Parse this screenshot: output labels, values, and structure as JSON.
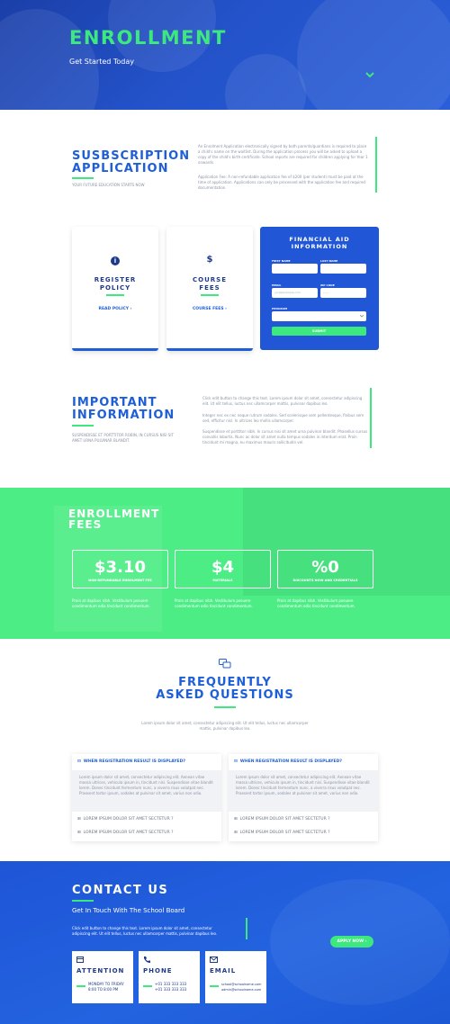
{
  "hero": {
    "title": "ENROLLMENT",
    "subtitle": "Get Started Today"
  },
  "subscription": {
    "title_line1": "SUSBSCRIPTION",
    "title_line2": "APPLICATION",
    "tagline": "YOUR FUTURE EDUCATION STARTS NOW",
    "para1": "An Enrolment Application electronically signed by both parents/guardians is required to place a child's name on the waitlist. During the application process you will be asked to upload a copy of the child's birth certificate. School reports are required for children applying for Year 1 onwards.",
    "para2": "Application Fee: A non-refundable application fee of $200 (per student) must be paid at the time of application. Applications can only be processed with the application fee and required documentation."
  },
  "cards": [
    {
      "title_line1": "REGISTER",
      "title_line2": "POLICY",
      "link": "READ POLICY",
      "icon": "info-icon",
      "icon_glyph": "i"
    },
    {
      "title_line1": "COURSE",
      "title_line2": "FEES",
      "link": "COURSE FEES",
      "icon": "dollar-icon",
      "icon_glyph": "$"
    }
  ],
  "aid_form": {
    "title_line1": "FINANCIAL AID",
    "title_line2": "INFORMATION",
    "first_name": "FIRST NAME",
    "last_name": "LAST NAME",
    "email": "EMAIL",
    "email_placeholder": "you@example.com",
    "zip": "ZIP CODE",
    "zip_placeholder": "------",
    "program": "PROGRAM",
    "submit": "SUBMIT"
  },
  "important": {
    "title_line1": "IMPORTANT",
    "title_line2": "INFORMATION",
    "tagline": "SUSPENDISSE ET PORTTITOR ROBIN, IN CURSUS NISI SIT AMET URNA PULVINAR BLANDIT.",
    "para1": "Click edit button to change this text. Lorem ipsum dolor sit amet, consectetur adipiscing elit. Ut elit tellus, luctus nec ullamcorper mattis, pulvinar dapibus leo.",
    "para2": "Integer nec ex nec neque rutrum sodales. Sed scelerisque sem pellentesque, finibus sem sed, efficitur nisl. In ultrices leo mollis ullamcorper.",
    "para3": "Suspendisse et porttitor nibh. In cursus nisi sit amet urna pulvinar blandit. Phasellus cursus convallis lobortis. Nunc ac dolor sit amet nulla tempus sodales in interdum erat. Proin tincidunt mi magna, eu maximus mauris sollicitudin vel."
  },
  "fees": {
    "title_line1": "ENROLLMENT",
    "title_line2": "FEES",
    "boxes": [
      {
        "value": "$3.10",
        "label": "NON-REFUNDABLE ENROLMENT FEE"
      },
      {
        "value": "$4",
        "label": "MATERIALS"
      },
      {
        "value": "%0",
        "label": "DISCOUNTS NOW AND CREDENTIALS"
      }
    ],
    "note": "Proin at dapibus nibh. Vestibulum posuere condimentum odio tincidunt condimentum."
  },
  "faq": {
    "title_line1": "FREQUENTLY",
    "title_line2": "ASKED QUESTIONS",
    "intro": "Lorem ipsum dolor sit amet, consectetur adipiscing elit. Ut elit tellus, luctus nec ullamcorper mattis, pulvinar dapibus leo.",
    "question": "WHEN REGISTRATION RESULT IS DISPLAYED?",
    "answer": "Lorem ipsum dolor sit amet, consectetur adipiscing elit. Aenean vitae massa ultrices, vehicula ipsum in, tincidunt nisi. Suspendisse vitae blandit lorem. Donec tincidunt fermentum nunc, a viverra risus volutpat nec. Praesent tortor ipsum, sodales at pulvinar sit amet, varius non odio.",
    "item": "LOREM IPSUM DOLOR SIT AMET SECTETUR ?"
  },
  "contact": {
    "title": "CONTACT US",
    "subtitle": "Get In Touch With The School Board",
    "text": "Click edit button to change this text. Lorem ipsum dolor sit amet, consectetur adipiscing elit. Ut elit tellus, luctus nec ullamcorper mattis, pulvinar dapibus leo.",
    "apply": "APPLY NOW",
    "boxes": [
      {
        "title": "ATTENTION",
        "line1": "MONDAY TO FRIDAY",
        "line2": "8:00 TO 8:00 PM"
      },
      {
        "title": "PHONE",
        "line1": "+01 333 333 333",
        "line2": "+01 333 333 333"
      },
      {
        "title": "EMAIL",
        "line1": "school@schoolname.com",
        "line2": "admin@schoolname.com"
      }
    ]
  },
  "colors": {
    "primary_blue": "#1e5fd8",
    "accent_green": "#3de87f"
  }
}
